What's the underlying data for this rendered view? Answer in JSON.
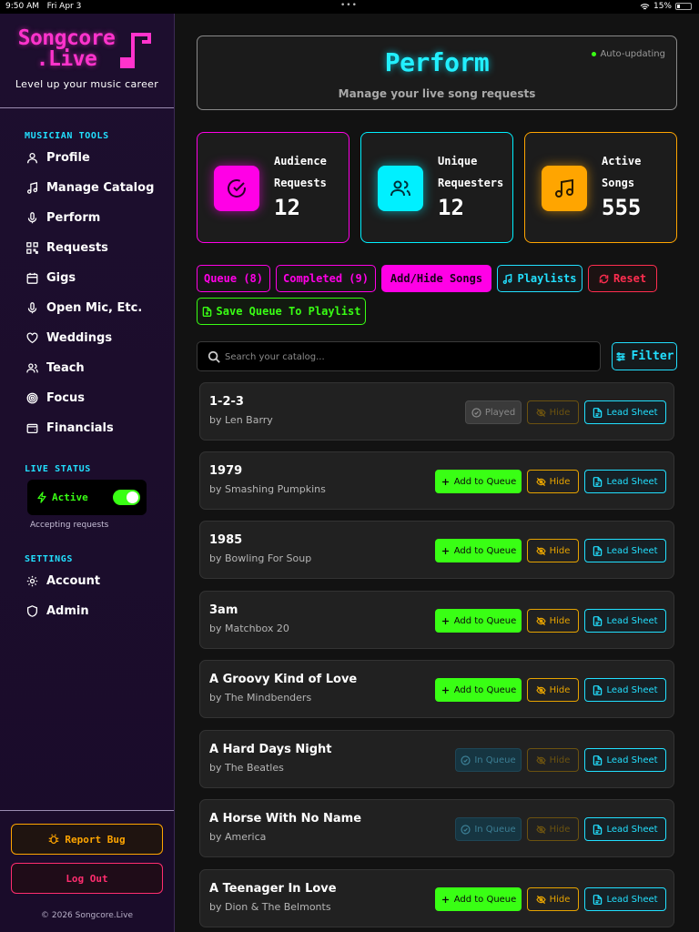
{
  "status_bar": {
    "time": "9:50 AM",
    "date": "Fri Apr 3",
    "battery": "15%"
  },
  "sidebar": {
    "logo_line1": "Songcore",
    "logo_line2": ".Live",
    "tagline": "Level up your music career",
    "musician_tools_heading": "MUSICIAN TOOLS",
    "nav": [
      {
        "label": "Profile",
        "icon": "user-icon"
      },
      {
        "label": "Manage Catalog",
        "icon": "music-note-icon"
      },
      {
        "label": "Perform",
        "icon": "microphone-icon"
      },
      {
        "label": "Requests",
        "icon": "qr-code-icon"
      },
      {
        "label": "Gigs",
        "icon": "calendar-icon"
      },
      {
        "label": "Open Mic, Etc.",
        "icon": "microphone-icon"
      },
      {
        "label": "Weddings",
        "icon": "heart-icon"
      },
      {
        "label": "Teach",
        "icon": "users-icon"
      },
      {
        "label": "Focus",
        "icon": "target-icon"
      },
      {
        "label": "Financials",
        "icon": "wallet-icon"
      }
    ],
    "live_status_heading": "LIVE STATUS",
    "live_label": "Active",
    "live_on": true,
    "accepting_text": "Accepting requests",
    "settings_heading": "SETTINGS",
    "settings": [
      {
        "label": "Account",
        "icon": "gear-icon"
      },
      {
        "label": "Admin",
        "icon": "shield-icon"
      }
    ],
    "report_bug": "Report Bug",
    "log_out": "Log Out",
    "copyright": "© 2026 Songcore.Live"
  },
  "hero": {
    "title": "Perform",
    "subtitle": "Manage your live song requests",
    "auto_updating": "Auto-updating"
  },
  "stats": [
    {
      "label_line1": "Audience",
      "label_line2": "Requests",
      "value": "12",
      "icon": "check-circle-icon",
      "color": "#ff00e6"
    },
    {
      "label_line1": "Unique",
      "label_line2": "Requesters",
      "value": "12",
      "icon": "users-icon",
      "color": "#00f0ff"
    },
    {
      "label_line1": "Active",
      "label_line2": "Songs",
      "value": "555",
      "icon": "music-note-icon",
      "color": "#ffa500"
    }
  ],
  "tabs": {
    "queue": "Queue (8)",
    "completed": "Completed (9)",
    "add_hide": "Add/Hide Songs",
    "playlists": "Playlists",
    "reset": "Reset",
    "save_queue": "Save Queue To Playlist"
  },
  "search": {
    "placeholder": "Search your catalog...",
    "value": ""
  },
  "filter_label": "Filter",
  "buttons": {
    "add": "Add to Queue",
    "played": "Played",
    "in_queue": "In Queue",
    "hide": "Hide",
    "lead_sheet": "Lead Sheet"
  },
  "songs": [
    {
      "title": "1-2-3",
      "artist": "by Len Barry",
      "state": "played"
    },
    {
      "title": "1979",
      "artist": "by Smashing Pumpkins",
      "state": "add"
    },
    {
      "title": "1985",
      "artist": "by Bowling For Soup",
      "state": "add"
    },
    {
      "title": "3am",
      "artist": "by Matchbox 20",
      "state": "add"
    },
    {
      "title": "A Groovy Kind of Love",
      "artist": "by The Mindbenders",
      "state": "add"
    },
    {
      "title": "A Hard Days Night",
      "artist": "by The Beatles",
      "state": "in_queue"
    },
    {
      "title": "A Horse With No Name",
      "artist": "by America",
      "state": "in_queue"
    },
    {
      "title": "A Teenager In Love",
      "artist": "by Dion & The Belmonts",
      "state": "add"
    }
  ]
}
